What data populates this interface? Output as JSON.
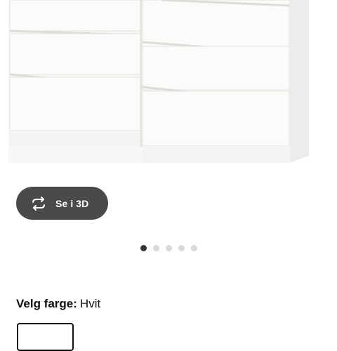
{
  "product": {
    "image_icon": "dresser-image",
    "view_3d_label": "Se i 3D",
    "view_3d_icon": "rotate-arrows-icon"
  },
  "carousel": {
    "total": 5,
    "active_index": 0
  },
  "color_selector": {
    "label": "Velg farge:",
    "value": "Hvit",
    "selected_swatch": "Hvit"
  },
  "colors": {
    "button_bg": "#4a4a4a",
    "dot_active": "#333333",
    "dot_inactive": "#d8d8d8"
  }
}
